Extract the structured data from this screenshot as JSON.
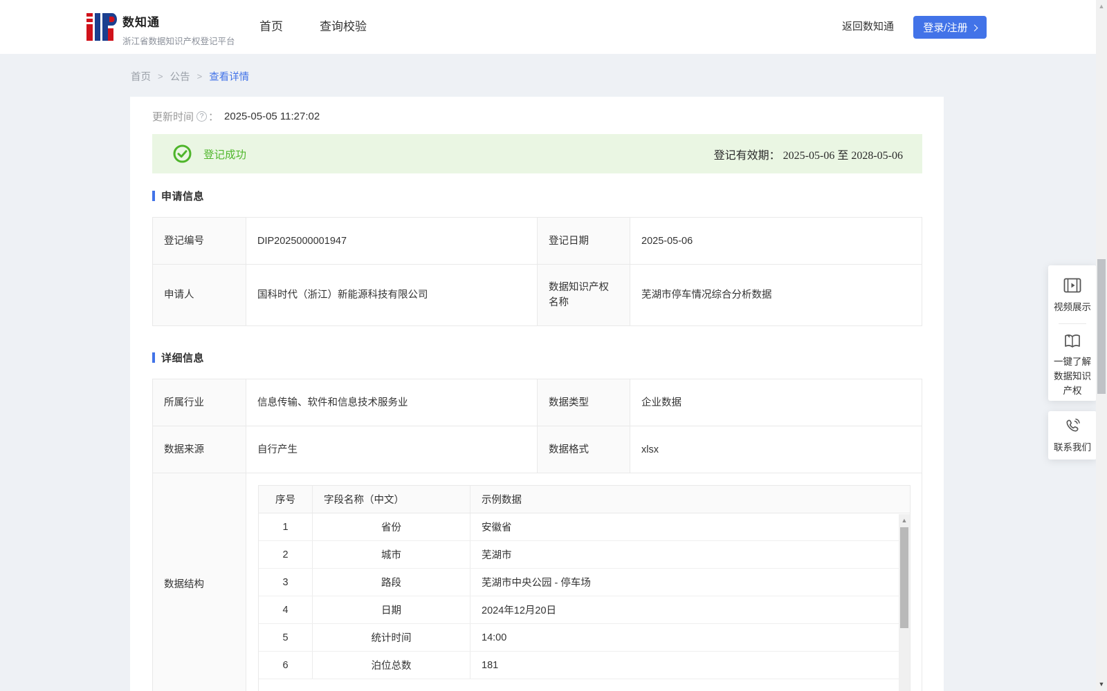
{
  "brand": {
    "name": "数知通",
    "subtitle": "浙江省数据知识产权登记平台"
  },
  "nav": {
    "home": "首页",
    "query": "查询校验",
    "back_link": "返回数知通",
    "login_button": "登录/注册"
  },
  "breadcrumb": {
    "home": "首页",
    "notice": "公告",
    "current": "查看详情",
    "separator": ">"
  },
  "detail": {
    "update_time_label": "更新时间",
    "help_glyph": "?",
    "colon": "：",
    "update_time_value": "2025-05-05 11:27:02",
    "status": {
      "text": "登记成功",
      "validity_label": "登记有效期：",
      "validity_value": "2025-05-06 至 2028-05-06"
    },
    "section_apply": "申请信息",
    "section_detail": "详细信息",
    "apply_info": {
      "reg_no_label": "登记编号",
      "reg_no": "DIP2025000001947",
      "reg_date_label": "登记日期",
      "reg_date": "2025-05-06",
      "applicant_label": "申请人",
      "applicant": "国科时代（浙江）新能源科技有限公司",
      "dip_name_label": "数据知识产权名称",
      "dip_name": "芜湖市停车情况综合分析数据"
    },
    "detail_info": {
      "industry_label": "所属行业",
      "industry": "信息传输、软件和信息技术服务业",
      "data_type_label": "数据类型",
      "data_type": "企业数据",
      "data_source_label": "数据来源",
      "data_source": "自行产生",
      "data_format_label": "数据格式",
      "data_format": "xlsx",
      "data_structure_label": "数据结构"
    },
    "structure_table": {
      "headers": [
        "序号",
        "字段名称（中文）",
        "示例数据"
      ],
      "rows": [
        [
          "1",
          "省份",
          "安徽省"
        ],
        [
          "2",
          "城市",
          "芜湖市"
        ],
        [
          "3",
          "路段",
          "芜湖市中央公园 - 停车场"
        ],
        [
          "4",
          "日期",
          "2024年12月20日"
        ],
        [
          "5",
          "统计时间",
          "14:00"
        ],
        [
          "6",
          "泊位总数",
          "181"
        ]
      ]
    }
  },
  "side_panel": {
    "video_label": "视频展示",
    "guide_label_line1": "一键了解",
    "guide_label_line2": "数据知识",
    "guide_label_line3": "产权",
    "contact_label": "联系我们"
  },
  "scrollbar": {
    "up_glyph": "▲",
    "down_glyph": "▼"
  },
  "colors": {
    "accent": "#4273e8",
    "success": "#50b72c",
    "success_bg": "#eaf6e3"
  }
}
